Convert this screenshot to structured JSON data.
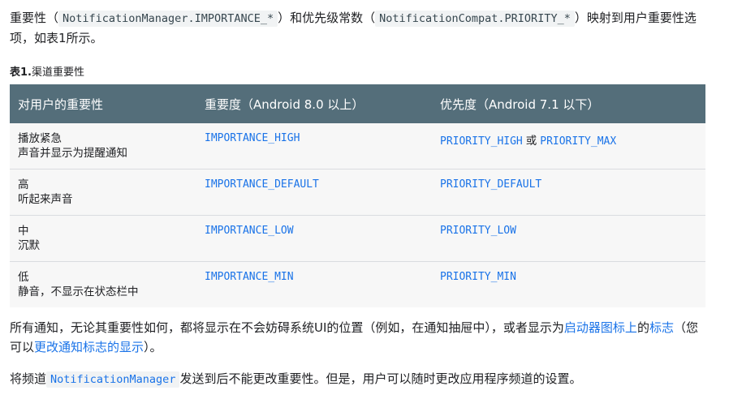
{
  "intro": {
    "t1": "重要性（",
    "code1": "NotificationManager.IMPORTANCE_*",
    "t2": "）和优先级常数（",
    "code2": "NotificationCompat.PRIORITY_*",
    "t3": "）映射到用户重要性选项，如表1所示。"
  },
  "caption": {
    "label": "表1.",
    "text": "渠道重要性"
  },
  "table": {
    "headers": [
      "对用户的重要性",
      "重要度（Android 8.0 以上）",
      "优先度（Android 7.1 以下）"
    ],
    "rows": [
      {
        "level": "播放紧急",
        "desc": "声音并显示为提醒通知",
        "importance": "IMPORTANCE_HIGH",
        "priority": "PRIORITY_HIGH",
        "or": "或",
        "priority2": "PRIORITY_MAX"
      },
      {
        "level": "高",
        "desc": "听起来声音",
        "importance": "IMPORTANCE_DEFAULT",
        "priority": "PRIORITY_DEFAULT"
      },
      {
        "level": "中",
        "desc": "沉默",
        "importance": "IMPORTANCE_LOW",
        "priority": "PRIORITY_LOW"
      },
      {
        "level": "低",
        "desc": "静音，不显示在状态栏中",
        "importance": "IMPORTANCE_MIN",
        "priority": "PRIORITY_MIN"
      }
    ]
  },
  "para2": {
    "t1": "所有通知，无论其重要性如何，都将显示在不会妨碍系统UI的位置（例如，在通知抽屉中），或者显示为",
    "link1": "启动器图标上",
    "t2": "的",
    "link2": "标志",
    "t3": "（您可以",
    "link3": "更改通知标志的显示",
    "t4": "）。"
  },
  "para3": {
    "t1": "将频道",
    "code": "NotificationManager",
    "t2": "发送到后不能更改重要性。但是，用户可以随时更改应用程序频道的设置。"
  }
}
